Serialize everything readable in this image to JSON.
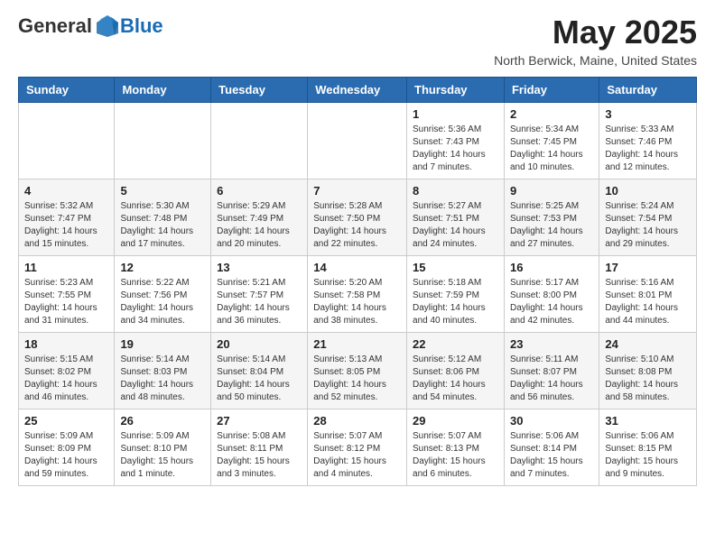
{
  "header": {
    "logo_general": "General",
    "logo_blue": "Blue",
    "month_title": "May 2025",
    "location": "North Berwick, Maine, United States"
  },
  "days_of_week": [
    "Sunday",
    "Monday",
    "Tuesday",
    "Wednesday",
    "Thursday",
    "Friday",
    "Saturday"
  ],
  "weeks": [
    [
      {
        "day": "",
        "info": ""
      },
      {
        "day": "",
        "info": ""
      },
      {
        "day": "",
        "info": ""
      },
      {
        "day": "",
        "info": ""
      },
      {
        "day": "1",
        "info": "Sunrise: 5:36 AM\nSunset: 7:43 PM\nDaylight: 14 hours\nand 7 minutes."
      },
      {
        "day": "2",
        "info": "Sunrise: 5:34 AM\nSunset: 7:45 PM\nDaylight: 14 hours\nand 10 minutes."
      },
      {
        "day": "3",
        "info": "Sunrise: 5:33 AM\nSunset: 7:46 PM\nDaylight: 14 hours\nand 12 minutes."
      }
    ],
    [
      {
        "day": "4",
        "info": "Sunrise: 5:32 AM\nSunset: 7:47 PM\nDaylight: 14 hours\nand 15 minutes."
      },
      {
        "day": "5",
        "info": "Sunrise: 5:30 AM\nSunset: 7:48 PM\nDaylight: 14 hours\nand 17 minutes."
      },
      {
        "day": "6",
        "info": "Sunrise: 5:29 AM\nSunset: 7:49 PM\nDaylight: 14 hours\nand 20 minutes."
      },
      {
        "day": "7",
        "info": "Sunrise: 5:28 AM\nSunset: 7:50 PM\nDaylight: 14 hours\nand 22 minutes."
      },
      {
        "day": "8",
        "info": "Sunrise: 5:27 AM\nSunset: 7:51 PM\nDaylight: 14 hours\nand 24 minutes."
      },
      {
        "day": "9",
        "info": "Sunrise: 5:25 AM\nSunset: 7:53 PM\nDaylight: 14 hours\nand 27 minutes."
      },
      {
        "day": "10",
        "info": "Sunrise: 5:24 AM\nSunset: 7:54 PM\nDaylight: 14 hours\nand 29 minutes."
      }
    ],
    [
      {
        "day": "11",
        "info": "Sunrise: 5:23 AM\nSunset: 7:55 PM\nDaylight: 14 hours\nand 31 minutes."
      },
      {
        "day": "12",
        "info": "Sunrise: 5:22 AM\nSunset: 7:56 PM\nDaylight: 14 hours\nand 34 minutes."
      },
      {
        "day": "13",
        "info": "Sunrise: 5:21 AM\nSunset: 7:57 PM\nDaylight: 14 hours\nand 36 minutes."
      },
      {
        "day": "14",
        "info": "Sunrise: 5:20 AM\nSunset: 7:58 PM\nDaylight: 14 hours\nand 38 minutes."
      },
      {
        "day": "15",
        "info": "Sunrise: 5:18 AM\nSunset: 7:59 PM\nDaylight: 14 hours\nand 40 minutes."
      },
      {
        "day": "16",
        "info": "Sunrise: 5:17 AM\nSunset: 8:00 PM\nDaylight: 14 hours\nand 42 minutes."
      },
      {
        "day": "17",
        "info": "Sunrise: 5:16 AM\nSunset: 8:01 PM\nDaylight: 14 hours\nand 44 minutes."
      }
    ],
    [
      {
        "day": "18",
        "info": "Sunrise: 5:15 AM\nSunset: 8:02 PM\nDaylight: 14 hours\nand 46 minutes."
      },
      {
        "day": "19",
        "info": "Sunrise: 5:14 AM\nSunset: 8:03 PM\nDaylight: 14 hours\nand 48 minutes."
      },
      {
        "day": "20",
        "info": "Sunrise: 5:14 AM\nSunset: 8:04 PM\nDaylight: 14 hours\nand 50 minutes."
      },
      {
        "day": "21",
        "info": "Sunrise: 5:13 AM\nSunset: 8:05 PM\nDaylight: 14 hours\nand 52 minutes."
      },
      {
        "day": "22",
        "info": "Sunrise: 5:12 AM\nSunset: 8:06 PM\nDaylight: 14 hours\nand 54 minutes."
      },
      {
        "day": "23",
        "info": "Sunrise: 5:11 AM\nSunset: 8:07 PM\nDaylight: 14 hours\nand 56 minutes."
      },
      {
        "day": "24",
        "info": "Sunrise: 5:10 AM\nSunset: 8:08 PM\nDaylight: 14 hours\nand 58 minutes."
      }
    ],
    [
      {
        "day": "25",
        "info": "Sunrise: 5:09 AM\nSunset: 8:09 PM\nDaylight: 14 hours\nand 59 minutes."
      },
      {
        "day": "26",
        "info": "Sunrise: 5:09 AM\nSunset: 8:10 PM\nDaylight: 15 hours\nand 1 minute."
      },
      {
        "day": "27",
        "info": "Sunrise: 5:08 AM\nSunset: 8:11 PM\nDaylight: 15 hours\nand 3 minutes."
      },
      {
        "day": "28",
        "info": "Sunrise: 5:07 AM\nSunset: 8:12 PM\nDaylight: 15 hours\nand 4 minutes."
      },
      {
        "day": "29",
        "info": "Sunrise: 5:07 AM\nSunset: 8:13 PM\nDaylight: 15 hours\nand 6 minutes."
      },
      {
        "day": "30",
        "info": "Sunrise: 5:06 AM\nSunset: 8:14 PM\nDaylight: 15 hours\nand 7 minutes."
      },
      {
        "day": "31",
        "info": "Sunrise: 5:06 AM\nSunset: 8:15 PM\nDaylight: 15 hours\nand 9 minutes."
      }
    ]
  ]
}
